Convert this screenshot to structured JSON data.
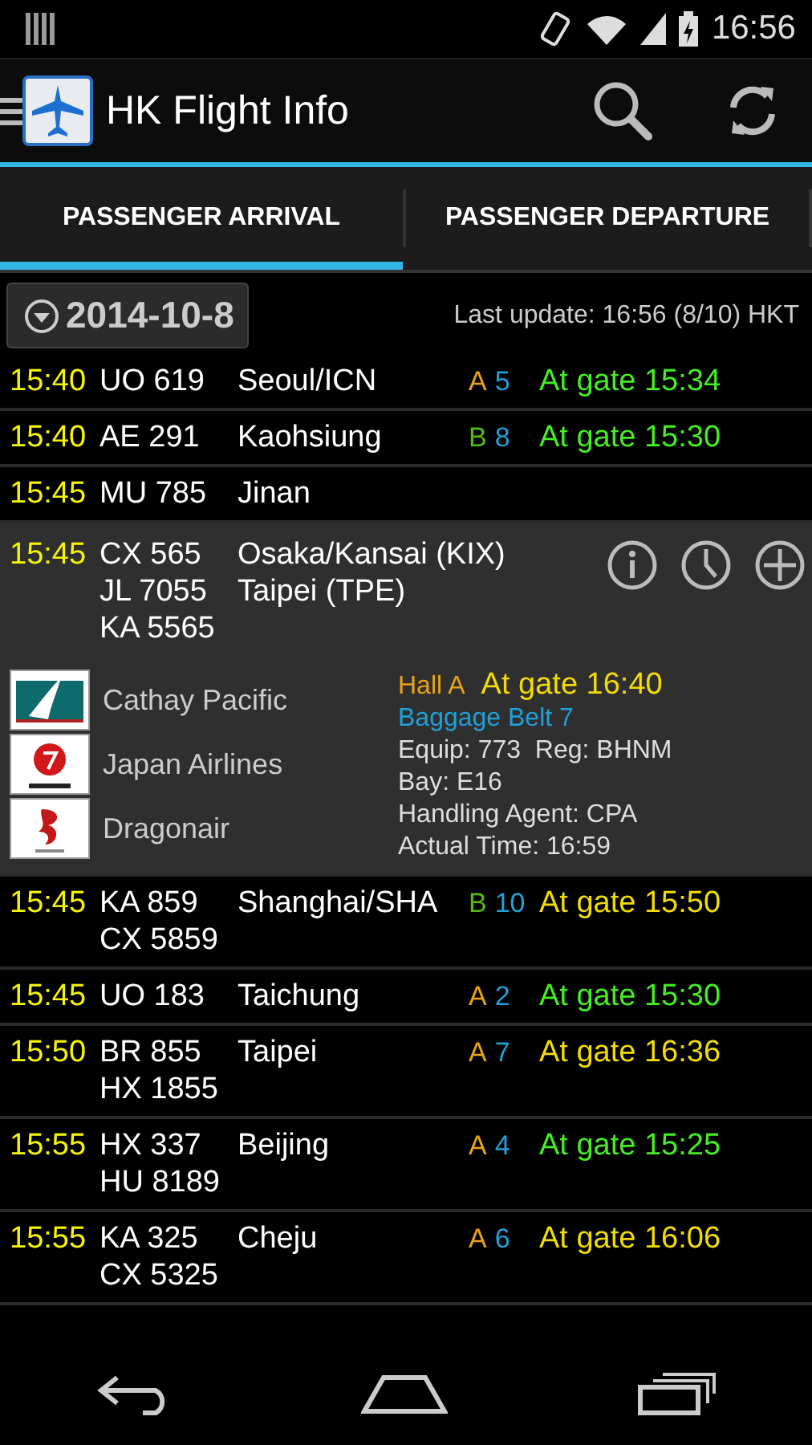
{
  "status_bar": {
    "time": "16:56"
  },
  "app_bar": {
    "title": "HK Flight Info"
  },
  "tabs": [
    {
      "label": "PASSENGER ARRIVAL",
      "selected": true
    },
    {
      "label": "PASSENGER DEPARTURE",
      "selected": false
    }
  ],
  "date_button": {
    "label": "2014-10-8"
  },
  "last_update": "Last update: 16:56 (8/10) HKT",
  "flights": [
    {
      "time": "15:40",
      "flights": [
        "UO 619"
      ],
      "cities": [
        "Seoul/ICN"
      ],
      "hall": {
        "text": "A",
        "color": "#e8a317"
      },
      "gate": "5",
      "status": {
        "text": "At gate 15:34",
        "color": "#44ee22"
      },
      "expanded": false
    },
    {
      "time": "15:40",
      "flights": [
        "AE 291"
      ],
      "cities": [
        "Kaohsiung"
      ],
      "hall": {
        "text": "B",
        "color": "#55bb11"
      },
      "gate": "8",
      "status": {
        "text": "At gate 15:30",
        "color": "#44ee22"
      },
      "expanded": false
    },
    {
      "time": "15:45",
      "flights": [
        "MU 785"
      ],
      "cities": [
        "Jinan"
      ],
      "expanded": false
    },
    {
      "time": "15:45",
      "flights": [
        "CX 565",
        "JL 7055",
        "KA 5565"
      ],
      "cities": [
        "Osaka/Kansai (KIX)",
        "Taipei (TPE)"
      ],
      "expanded": true,
      "airlines": [
        {
          "name": "Cathay Pacific",
          "kind": "cathay"
        },
        {
          "name": "Japan Airlines",
          "kind": "jal"
        },
        {
          "name": "Dragonair",
          "kind": "dragon"
        }
      ],
      "hall_label": "Hall A",
      "status": {
        "text": "At gate 16:40",
        "color": "#f2dc00"
      },
      "baggage": "Baggage Belt 7",
      "details": [
        "Equip: 773  Reg: BHNM",
        "Bay: E16",
        "Handling Agent: CPA",
        "Actual Time: 16:59"
      ]
    },
    {
      "time": "15:45",
      "flights": [
        "KA 859",
        "CX 5859"
      ],
      "cities": [
        "Shanghai/SHA"
      ],
      "hall": {
        "text": "B",
        "color": "#55bb11"
      },
      "gate": "10",
      "status": {
        "text": "At gate 15:50",
        "color": "#f2dc00"
      },
      "expanded": false
    },
    {
      "time": "15:45",
      "flights": [
        "UO 183"
      ],
      "cities": [
        "Taichung"
      ],
      "hall": {
        "text": "A",
        "color": "#e8a317"
      },
      "gate": "2",
      "status": {
        "text": "At gate 15:30",
        "color": "#44ee22"
      },
      "expanded": false
    },
    {
      "time": "15:50",
      "flights": [
        "BR 855",
        "HX 1855"
      ],
      "cities": [
        "Taipei"
      ],
      "hall": {
        "text": "A",
        "color": "#e8a317"
      },
      "gate": "7",
      "status": {
        "text": "At gate 16:36",
        "color": "#f2dc00"
      },
      "expanded": false
    },
    {
      "time": "15:55",
      "flights": [
        "HX 337",
        "HU 8189"
      ],
      "cities": [
        "Beijing"
      ],
      "hall": {
        "text": "A",
        "color": "#e8a317"
      },
      "gate": "4",
      "status": {
        "text": "At gate 15:25",
        "color": "#44ee22"
      },
      "expanded": false
    },
    {
      "time": "15:55",
      "flights": [
        "KA 325",
        "CX 5325"
      ],
      "cities": [
        "Cheju"
      ],
      "hall": {
        "text": "A",
        "color": "#e8a317"
      },
      "gate": "6",
      "status": {
        "text": "At gate 16:06",
        "color": "#f2dc00"
      },
      "expanded": false
    }
  ]
}
